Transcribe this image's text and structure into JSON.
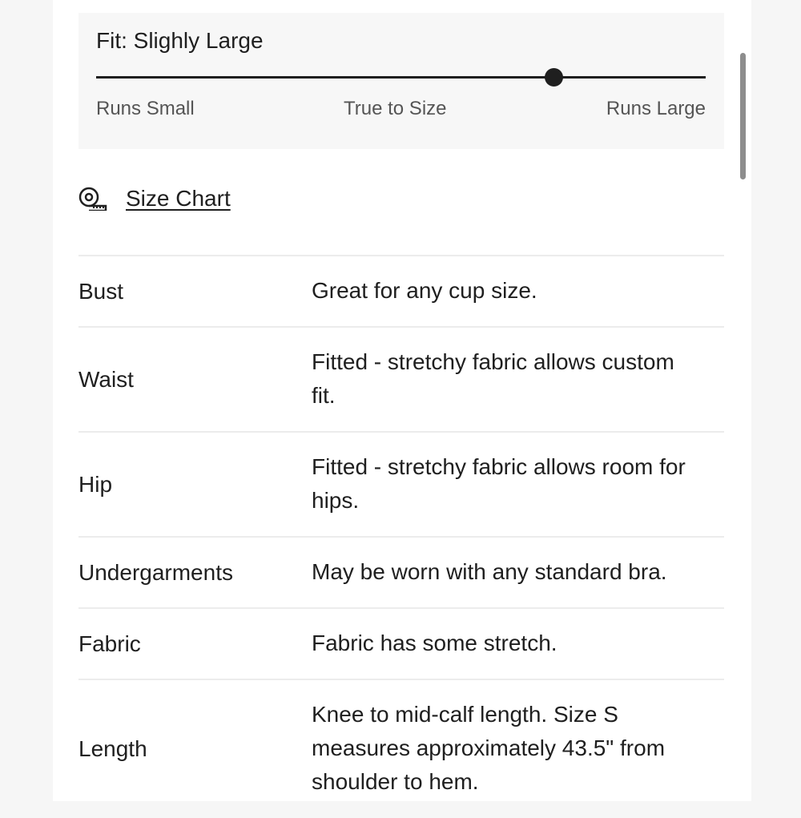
{
  "fit": {
    "title": "Fit: Slighly Large",
    "scale_position": 0.75,
    "labels": {
      "small": "Runs Small",
      "true": "True to Size",
      "large": "Runs Large"
    }
  },
  "size_chart": {
    "icon": "measuring-tape-icon",
    "label": "Size Chart"
  },
  "specs": [
    {
      "name": "Bust",
      "lines": [
        "Great for any cup size."
      ]
    },
    {
      "name": "Waist",
      "lines": [
        "Fitted - stretchy fabric allows custom",
        "fit."
      ]
    },
    {
      "name": "Hip",
      "lines": [
        "Fitted - stretchy fabric allows room for",
        "hips."
      ]
    },
    {
      "name": "Undergarments",
      "lines": [
        "May be worn with any standard bra."
      ]
    },
    {
      "name": "Fabric",
      "lines": [
        "Fabric has some stretch."
      ]
    },
    {
      "name": "Length",
      "lines": [
        "Knee to mid-calf length. Size S",
        "measures approximately 43.5\" from",
        "shoulder to hem."
      ]
    }
  ]
}
